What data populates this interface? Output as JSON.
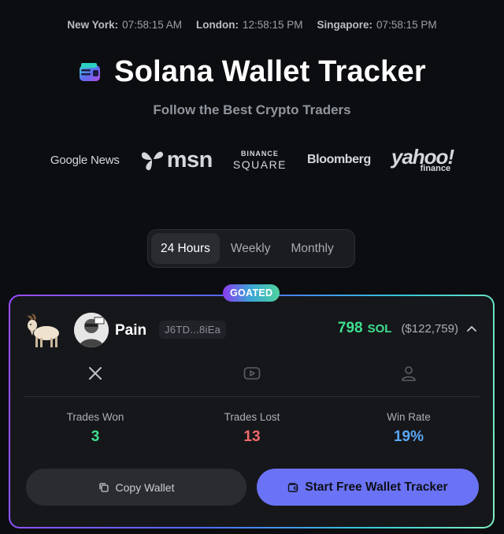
{
  "clocks": [
    {
      "city": "New York:",
      "time": "07:58:15 AM"
    },
    {
      "city": "London:",
      "time": "12:58:15 PM"
    },
    {
      "city": "Singapore:",
      "time": "07:58:15 PM"
    }
  ],
  "header": {
    "title": "Solana Wallet Tracker",
    "subtitle": "Follow the Best Crypto Traders"
  },
  "press": {
    "google_news": "Google News",
    "msn": "msn",
    "binance_top": "BINANCE",
    "binance_bottom": "SQUARE",
    "bloomberg": "Bloomberg",
    "yahoo": "yahoo!",
    "yahoo_sub": "finance"
  },
  "tabs": [
    {
      "label": "24 Hours",
      "active": true
    },
    {
      "label": "Weekly",
      "active": false
    },
    {
      "label": "Monthly",
      "active": false
    }
  ],
  "card": {
    "badge": "GOATED",
    "trader_name": "Pain",
    "address": "J6TD...8iEa",
    "balance": "798",
    "balance_unit": "SOL",
    "balance_usd": "($122,759)",
    "stats": {
      "won_label": "Trades Won",
      "won_value": "3",
      "lost_label": "Trades Lost",
      "lost_value": "13",
      "winrate_label": "Win Rate",
      "winrate_value": "19%"
    },
    "copy_button": "Copy Wallet",
    "start_button": "Start Free Wallet Tracker"
  },
  "colors": {
    "positive": "#3ee08f",
    "negative": "#f06a6a",
    "winrate": "#5aa7f5",
    "accent_button": "#6a73f5"
  },
  "icons": {
    "social": [
      "x-icon",
      "youtube-icon",
      "profile-icon"
    ]
  }
}
